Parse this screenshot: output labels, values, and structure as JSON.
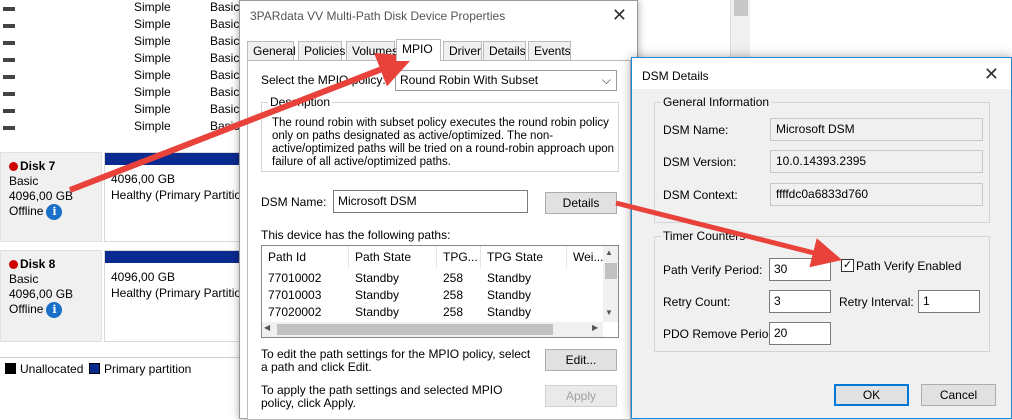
{
  "background": {
    "volumes": [
      {
        "layout": "Simple",
        "type": "Basic"
      },
      {
        "layout": "Simple",
        "type": "Basic"
      },
      {
        "layout": "Simple",
        "type": "Basic"
      },
      {
        "layout": "Simple",
        "type": "Basic"
      },
      {
        "layout": "Simple",
        "type": "Basic"
      },
      {
        "layout": "Simple",
        "type": "Basic"
      },
      {
        "layout": "Simple",
        "type": "Basic"
      },
      {
        "layout": "Simple",
        "type": "Basic"
      }
    ],
    "disks": [
      {
        "name": "Disk 7",
        "kind": "Basic",
        "size": "4096,00 GB",
        "status": "Offline",
        "part_size": "4096,00 GB",
        "part_status": "Healthy (Primary Partition)"
      },
      {
        "name": "Disk 8",
        "kind": "Basic",
        "size": "4096,00 GB",
        "status": "Offline",
        "part_size": "4096,00 GB",
        "part_status": "Healthy (Primary Partition)"
      }
    ],
    "legend": {
      "unallocated": "Unallocated",
      "primary": "Primary partition"
    },
    "colors": {
      "primary_partition": "#0b2a8f",
      "offline_icon": "#cc0000",
      "info_icon": "#1a6fc9",
      "arrow": "#e8423a"
    }
  },
  "props": {
    "title": "3PARdata VV  Multi-Path Disk Device Properties",
    "close_glyph": "✕",
    "tabs": [
      "General",
      "Policies",
      "Volumes",
      "MPIO",
      "Driver",
      "Details",
      "Events"
    ],
    "active_tab": "MPIO",
    "policy_label": "Select the MPIO policy:",
    "policy_value": "Round Robin With Subset",
    "description_label": "Description",
    "description_text": "The round robin with subset policy executes the round robin policy only on paths designated as active/optimized.  The non-active/optimized paths will be tried on a round-robin approach upon failure of all active/optimized paths.",
    "dsm_name_label": "DSM Name:",
    "dsm_name_value": "Microsoft DSM",
    "details_button": "Details",
    "paths_label": "This device has the following paths:",
    "paths_columns": [
      "Path Id",
      "Path State",
      "TPG...",
      "TPG State",
      "Wei..."
    ],
    "paths_rows": [
      [
        "77010002",
        "Standby",
        "258",
        "Standby"
      ],
      [
        "77010003",
        "Standby",
        "258",
        "Standby"
      ],
      [
        "77020002",
        "Standby",
        "258",
        "Standby"
      ]
    ],
    "edit_text": "To edit the path settings for the MPIO policy, select a path and click Edit.",
    "edit_button": "Edit...",
    "apply_text": "To apply the path settings and selected MPIO policy, click Apply.",
    "apply_button": "Apply"
  },
  "dsm": {
    "title": "DSM Details",
    "close_glyph": "✕",
    "general_label": "General Information",
    "name_label": "DSM Name:",
    "name_value": "Microsoft DSM",
    "version_label": "DSM Version:",
    "version_value": "10.0.14393.2395",
    "context_label": "DSM Context:",
    "context_value": "ffffdc0a6833d760",
    "timer_label": "Timer Counters",
    "pv_period_label": "Path Verify Period:",
    "pv_period_value": "30",
    "pv_enabled_label": "Path Verify Enabled",
    "pv_enabled_checked": true,
    "retry_count_label": "Retry Count:",
    "retry_count_value": "3",
    "retry_interval_label": "Retry Interval:",
    "retry_interval_value": "1",
    "pdo_label": "PDO Remove Period:",
    "pdo_value": "20",
    "ok_button": "OK",
    "cancel_button": "Cancel"
  }
}
